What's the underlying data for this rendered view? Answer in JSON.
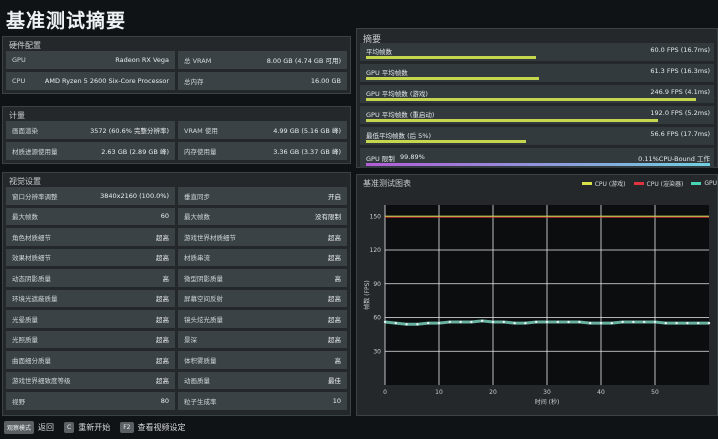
{
  "title": "基准测试摘要",
  "hardware": {
    "title": "硬件配置",
    "rows": [
      [
        {
          "label": "GPU",
          "value": "Radeon RX Vega"
        },
        {
          "label": "总 VRAM",
          "value": "8.00 GB (4.74 GB 可用)"
        }
      ],
      [
        {
          "label": "CPU",
          "value": "AMD Ryzen 5 2600 Six-Core Processor"
        },
        {
          "label": "总内存",
          "value": "16.00 GB"
        }
      ]
    ]
  },
  "compute": {
    "title": "计量",
    "rows": [
      [
        {
          "label": "画面渲染",
          "value": "3572 (60.6% 完整分辨率)"
        },
        {
          "label": "VRAM 使用",
          "value": "4.99 GB (5.16 GB 峰)"
        }
      ],
      [
        {
          "label": "材质进源使用量",
          "value": "2.63 GB (2.89 GB 峰)"
        },
        {
          "label": "内存使用量",
          "value": "3.36 GB (3.37 GB 峰)"
        }
      ]
    ]
  },
  "settings": {
    "title": "视觉设置",
    "rows": [
      [
        {
          "label": "窗口分辨率调整",
          "value": "3840x2160 (100.0%)"
        },
        {
          "label": "垂直同步",
          "value": "开启"
        }
      ],
      [
        {
          "label": "最大帧数",
          "value": "60"
        },
        {
          "label": "最大帧数",
          "value": "没有限制"
        }
      ],
      [
        {
          "label": "角色材质细节",
          "value": "超高"
        },
        {
          "label": "游戏世界材质细节",
          "value": "超高"
        }
      ],
      [
        {
          "label": "效果材质细节",
          "value": "超高"
        },
        {
          "label": "材质串流",
          "value": "超高"
        }
      ],
      [
        {
          "label": "动态阴影质量",
          "value": "高"
        },
        {
          "label": "微型阴影质量",
          "value": "高"
        }
      ],
      [
        {
          "label": "环境光遮蔽质量",
          "value": "超高"
        },
        {
          "label": "屏幕空间反射",
          "value": "超高"
        }
      ],
      [
        {
          "label": "光晕质量",
          "value": "超高"
        },
        {
          "label": "镜头炫光质量",
          "value": "超高"
        }
      ],
      [
        {
          "label": "光照质量",
          "value": "超高"
        },
        {
          "label": "景深",
          "value": "超高"
        }
      ],
      [
        {
          "label": "曲面细分质量",
          "value": "超高"
        },
        {
          "label": "体积雾质量",
          "value": "高"
        }
      ],
      [
        {
          "label": "游戏世界细致度等级",
          "value": "超高"
        },
        {
          "label": "动画质量",
          "value": "最佳"
        }
      ],
      [
        {
          "label": "视野",
          "value": "80"
        },
        {
          "label": "粒子生成率",
          "value": "10"
        }
      ]
    ]
  },
  "summary": {
    "title": "摘要",
    "rows": [
      {
        "label": "平均帧数",
        "value": "60.0 FPS (16.7ms)",
        "fill": 0.5
      },
      {
        "label": "GPU 平均帧数",
        "value": "61.3 FPS (16.3ms)",
        "fill": 0.51
      },
      {
        "label": "GPU 平均帧数 (游戏)",
        "value": "246.9 FPS (4.1ms)",
        "fill": 0.97
      },
      {
        "label": "GPU 平均帧数 (重启动)",
        "value": "192.0 FPS (5.2ms)",
        "fill": 0.86
      },
      {
        "label": "最低平均帧数 (后 5%)",
        "value": "56.6 FPS (17.7ms)",
        "fill": 0.47
      }
    ],
    "util": {
      "label": "GPU 限制",
      "pct": "99.89%",
      "value": "0.11%CPU-Bound 工作"
    }
  },
  "chart_data": {
    "type": "scatter",
    "title": "基准测试图表",
    "xlabel": "时间 (秒)",
    "ylabel": "帧数 (FPS)",
    "xlim": [
      0,
      60
    ],
    "ylim": [
      0,
      160
    ],
    "xticks": [
      0,
      10,
      20,
      30,
      40,
      50
    ],
    "yticks": [
      30,
      60,
      90,
      120,
      150
    ],
    "legend": [
      {
        "name": "CPU (游戏)",
        "color": "#d8e04a"
      },
      {
        "name": "CPU (渲染器)",
        "color": "#e0333f"
      },
      {
        "name": "GPU",
        "color": "#4ad2b5"
      }
    ],
    "series": [
      {
        "name": "CPU (游戏)",
        "color": "#d8e04a",
        "y_const": 150
      },
      {
        "name": "GPU",
        "color": "#7fd9c4",
        "x": [
          0,
          2,
          4,
          6,
          8,
          10,
          12,
          14,
          16,
          18,
          20,
          22,
          24,
          26,
          28,
          30,
          32,
          34,
          36,
          38,
          40,
          42,
          44,
          46,
          48,
          50,
          52,
          54,
          56,
          58,
          60
        ],
        "values": [
          56,
          55,
          54,
          54,
          55,
          55,
          56,
          56,
          56,
          57,
          56,
          56,
          55,
          55,
          56,
          56,
          56,
          56,
          56,
          55,
          55,
          55,
          56,
          56,
          56,
          56,
          55,
          55,
          55,
          55,
          55
        ]
      }
    ]
  },
  "bottom_bar": {
    "mode_label": "观察模式",
    "back_label": "返回",
    "restart_key": "C",
    "restart_label": "重新开始",
    "video_key": "F2",
    "video_label": "查看视频设定"
  }
}
